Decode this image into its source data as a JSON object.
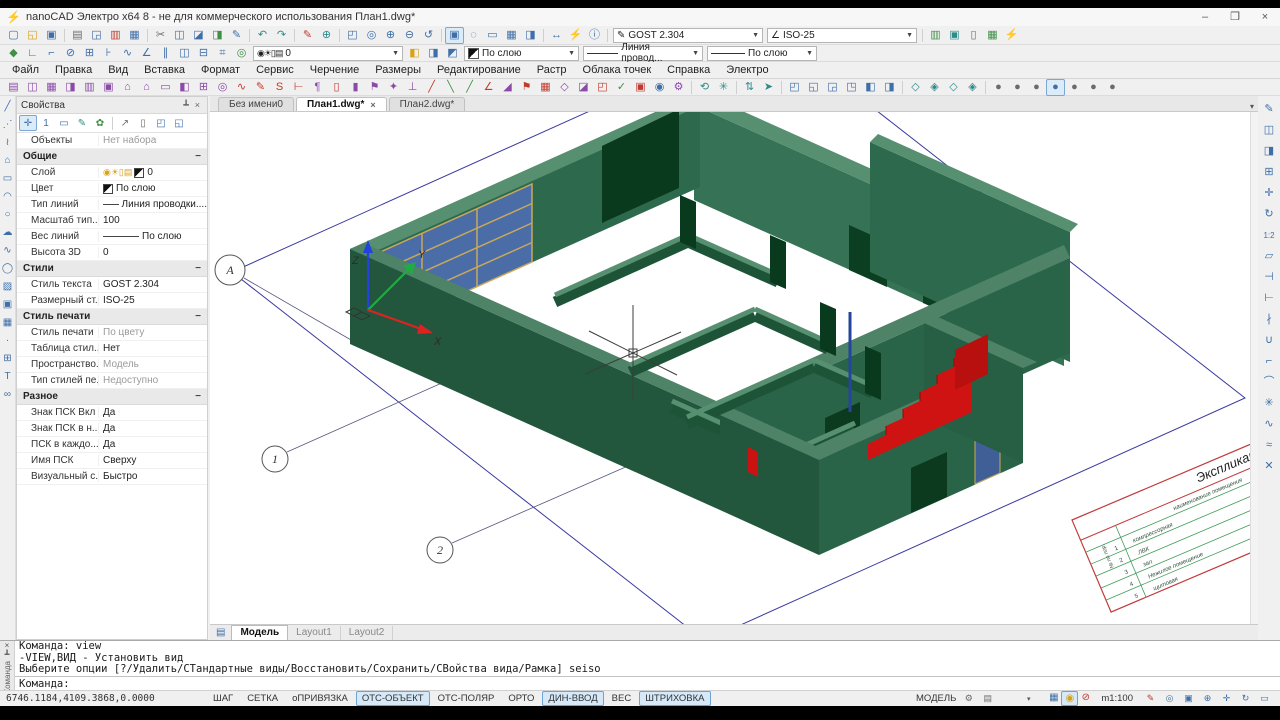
{
  "window": {
    "title": "nanoCAD Электро x64 8 - не для коммерческого использования План1.dwg*",
    "app_icon": "⚡",
    "controls": {
      "minimize": "–",
      "maximize": "❒",
      "close": "×"
    }
  },
  "menu": {
    "items": [
      "Файл",
      "Правка",
      "Вид",
      "Вставка",
      "Формат",
      "Сервис",
      "Черчение",
      "Размеры",
      "Редактирование",
      "Растр",
      "Облака точек",
      "Справка",
      "Электро"
    ]
  },
  "toolbar1": {
    "icons": [
      [
        "new",
        "▢",
        "b"
      ],
      [
        "open",
        "◱",
        "y"
      ],
      [
        "save",
        "▣",
        "b"
      ],
      [
        "|"
      ],
      [
        "print",
        "▤",
        "k"
      ],
      [
        "preview",
        "◲",
        "b"
      ],
      [
        "plot",
        "▥",
        "r"
      ],
      [
        "publish",
        "▦",
        "b"
      ],
      [
        "|"
      ],
      [
        "cut",
        "✂",
        "k"
      ],
      [
        "copy",
        "◫",
        "b"
      ],
      [
        "paste",
        "◪",
        "b"
      ],
      [
        "paste-format",
        "◨",
        "g"
      ],
      [
        "match-props",
        "✎",
        "b"
      ],
      [
        "|"
      ],
      [
        "undo",
        "↶",
        "t"
      ],
      [
        "redo",
        "↷",
        "t"
      ],
      [
        "|"
      ],
      [
        "marker",
        "✎",
        "r"
      ],
      [
        "attach",
        "⊕",
        "t"
      ],
      [
        "|"
      ],
      [
        "zoom-window",
        "◰",
        "b"
      ],
      [
        "zoom-dynamic",
        "◎",
        "b"
      ],
      [
        "zoom-in",
        "⊕",
        "b"
      ],
      [
        "zoom-out",
        "⊖",
        "b"
      ],
      [
        "zoom-previous",
        "↺",
        "b"
      ],
      [
        "|"
      ],
      [
        "panels",
        "▣",
        "b",
        1
      ],
      [
        "search",
        "◌",
        "b"
      ],
      [
        "screen",
        "▭",
        "b"
      ],
      [
        "sheets",
        "▦",
        "b"
      ],
      [
        "properties",
        "◨",
        "b"
      ],
      [
        "|"
      ],
      [
        "distance",
        "↔",
        "b"
      ],
      [
        "quick-measure",
        "⚡",
        "y"
      ],
      [
        "info",
        "ⓘ",
        "b"
      ]
    ],
    "text_style": {
      "icon": "✎",
      "value": "GOST 2.304"
    },
    "dim_style": {
      "icon": "∠",
      "value": "ISO-25"
    },
    "right_icons": [
      [
        "el-base",
        "▥",
        "g"
      ],
      [
        "el-model",
        "▣",
        "t"
      ],
      [
        "el-doc",
        "▯",
        "k"
      ],
      [
        "el-table",
        "▦",
        "g"
      ],
      [
        "el-run",
        "⚡",
        "t"
      ]
    ]
  },
  "toolbar2": {
    "icons": [
      [
        "snap-settings",
        "◆",
        "g"
      ],
      [
        "osnap",
        "∟",
        "b"
      ],
      [
        "ortho-mode",
        "⌐",
        "b"
      ],
      [
        "no-track",
        "⊘",
        "b"
      ],
      [
        "track",
        "⊞",
        "b"
      ],
      [
        "dyn-input",
        "⊦",
        "b"
      ],
      [
        "wave",
        "∿",
        "b"
      ],
      [
        "angle",
        "∠",
        "b"
      ],
      [
        "parallel",
        "∥",
        "b"
      ],
      [
        "copy-mode",
        "◫",
        "b"
      ],
      [
        "array-mode",
        "⊟",
        "b"
      ],
      [
        "grid-mode",
        "⌗",
        "b"
      ],
      [
        "magnet",
        "◎",
        "g"
      ]
    ],
    "layer": {
      "icons": "◉☀▯▤",
      "value": "0"
    },
    "locks": [
      [
        "lock-layer",
        "◧",
        "y"
      ],
      [
        "lock-object",
        "◨",
        "b"
      ],
      [
        "lock-vp",
        "◩",
        "b"
      ]
    ],
    "color": {
      "value": "По слою"
    },
    "linetype": {
      "value": "Линия провод..."
    },
    "lineweight": {
      "value": "По слою"
    }
  },
  "toolbar3": {
    "icons": [
      [
        "project-doc",
        "▤",
        "p"
      ],
      [
        "project-open",
        "◫",
        "p"
      ],
      [
        "project-props",
        "▦",
        "p"
      ],
      [
        "project-export",
        "◨",
        "p"
      ],
      [
        "db-manager",
        "▥",
        "p"
      ],
      [
        "db-element",
        "▣",
        "p"
      ],
      [
        "building",
        "⌂",
        "p"
      ],
      [
        "floor",
        "⌂",
        "p"
      ],
      [
        "room",
        "▭",
        "p"
      ],
      [
        "zone",
        "◧",
        "p"
      ],
      [
        "grid-plan",
        "⊞",
        "p"
      ],
      [
        "equipment",
        "◎",
        "p"
      ],
      [
        "wire",
        "∿",
        "r"
      ],
      [
        "wire-draw",
        "✎",
        "r"
      ],
      [
        "wire-curve",
        "S",
        "r"
      ],
      [
        "wire-tap",
        "⊢",
        "r"
      ],
      [
        "section",
        "¶",
        "p"
      ],
      [
        "cabinet",
        "▯",
        "r"
      ],
      [
        "cabinet2",
        "▮",
        "p"
      ],
      [
        "mark",
        "⚑",
        "p"
      ],
      [
        "luminaire",
        "✦",
        "p"
      ],
      [
        "pole",
        "⊥",
        "p"
      ],
      [
        "trace1",
        "╱",
        "r"
      ],
      [
        "trace2",
        "╲",
        "g"
      ],
      [
        "trace3",
        "╱",
        "g"
      ],
      [
        "angle-set",
        "∠",
        "r"
      ],
      [
        "triangle",
        "◢",
        "p"
      ],
      [
        "flag",
        "⚑",
        "r"
      ],
      [
        "panel-board",
        "▦",
        "r"
      ],
      [
        "diamond",
        "◇",
        "p"
      ],
      [
        "swatch-tool",
        "◪",
        "p"
      ],
      [
        "window-tool",
        "◰",
        "r"
      ],
      [
        "check",
        "✓",
        "g"
      ],
      [
        "report",
        "▣",
        "r"
      ],
      [
        "camera",
        "◉",
        "b"
      ],
      [
        "settings",
        "⚙",
        "p"
      ]
    ],
    "nav_icons": [
      [
        "orbit",
        "⟲",
        "t"
      ],
      [
        "orbit-free",
        "✳",
        "t"
      ],
      [
        "|"
      ],
      [
        "walk",
        "⇅",
        "t"
      ],
      [
        "fly",
        "➤",
        "t"
      ],
      [
        "|"
      ],
      [
        "view-top",
        "◰",
        "b"
      ],
      [
        "view-bottom",
        "◱",
        "b"
      ],
      [
        "view-left",
        "◲",
        "b"
      ],
      [
        "view-right",
        "◳",
        "b"
      ],
      [
        "view-front",
        "◧",
        "b"
      ],
      [
        "view-back",
        "◨",
        "b"
      ],
      [
        "|"
      ],
      [
        "iso-sw",
        "◇",
        "t"
      ],
      [
        "iso-se",
        "◈",
        "t"
      ],
      [
        "iso-ne",
        "◇",
        "t"
      ],
      [
        "iso-nw",
        "◈",
        "t"
      ],
      [
        "|"
      ],
      [
        "vs-2d",
        "●",
        "k"
      ],
      [
        "vs-wireframe",
        "●",
        "k"
      ],
      [
        "vs-hidden",
        "●",
        "k"
      ],
      [
        "vs-shaded",
        "●",
        "b",
        1
      ],
      [
        "vs-gouraud",
        "●",
        "k"
      ],
      [
        "vs-flat",
        "●",
        "k"
      ],
      [
        "vs-xray",
        "●",
        "k"
      ]
    ]
  },
  "left_toolbar": {
    "icons": [
      [
        "line",
        "╱",
        "b"
      ],
      [
        "ray",
        "⋰",
        "b"
      ],
      [
        "polyline",
        "≀",
        "b"
      ],
      [
        "polygon",
        "⌂",
        "b"
      ],
      [
        "rectangle",
        "▭",
        "b"
      ],
      [
        "arc",
        "◠",
        "b"
      ],
      [
        "circle",
        "○",
        "b"
      ],
      [
        "cloud",
        "☁",
        "b"
      ],
      [
        "spline",
        "∿",
        "b"
      ],
      [
        "ellipse",
        "◯",
        "b"
      ],
      [
        "hatch",
        "▨",
        "b"
      ],
      [
        "region",
        "▣",
        "b"
      ],
      [
        "image",
        "▦",
        "b"
      ],
      [
        "point",
        "·",
        "b"
      ],
      [
        "table",
        "⊞",
        "b"
      ],
      [
        "text",
        "T",
        "b"
      ],
      [
        "group",
        "∞",
        "b"
      ]
    ]
  },
  "right_toolbar": {
    "icons": [
      [
        "erase",
        "✎",
        "b"
      ],
      [
        "copy-obj",
        "◫",
        "b"
      ],
      [
        "mirror",
        "◨",
        "b"
      ],
      [
        "array",
        "⊞",
        "b"
      ],
      [
        "move",
        "✛",
        "b"
      ],
      [
        "rotate",
        "↻",
        "b"
      ],
      [
        "scale",
        "1:2",
        "txt"
      ],
      [
        "stretch",
        "▱",
        "b"
      ],
      [
        "trim",
        "⊣",
        "b"
      ],
      [
        "extend",
        "⊢",
        "b"
      ],
      [
        "break",
        "∤",
        "b"
      ],
      [
        "join",
        "∪",
        "b"
      ],
      [
        "chamfer",
        "⌐",
        "b"
      ],
      [
        "fillet",
        "⌒",
        "b"
      ],
      [
        "explode",
        "✳",
        "b"
      ],
      [
        "pedit",
        "∿",
        "b"
      ],
      [
        "spline-edit",
        "≈",
        "b"
      ],
      [
        "delete",
        "✕",
        "b"
      ]
    ]
  },
  "properties": {
    "title": "Свойства",
    "pin": "┻",
    "close": "×",
    "collapse_glyph": "−",
    "toolbar_icons": [
      [
        "select-append",
        "✛",
        "b",
        1
      ],
      [
        "select-single",
        "1",
        "b"
      ],
      [
        "calc",
        "▭",
        "b"
      ],
      [
        "quick-select",
        "✎",
        "t"
      ],
      [
        "filter",
        "✿",
        "g"
      ],
      [
        "|"
      ],
      [
        "copy-props",
        "↗",
        "k"
      ],
      [
        "paste-props",
        "▯",
        "k"
      ],
      [
        "pin-sel",
        "◰",
        "b"
      ],
      [
        "pin-sel2",
        "◱",
        "b"
      ]
    ],
    "rows": [
      {
        "type": "row",
        "label": "Объекты",
        "value": "Нет набора",
        "muted": true
      },
      {
        "type": "section",
        "label": "Общие"
      },
      {
        "type": "row",
        "label": "Слой",
        "value": "0",
        "extra": "layericons"
      },
      {
        "type": "row",
        "label": "Цвет",
        "value": "По слою",
        "extra": "swatch"
      },
      {
        "type": "row",
        "label": "Тип линий",
        "value": "Линия проводки....",
        "extra": "line"
      },
      {
        "type": "row",
        "label": "Масштаб тип...",
        "value": "100"
      },
      {
        "type": "row",
        "label": "Вес линий",
        "value": "По слою",
        "extra": "line"
      },
      {
        "type": "row",
        "label": "Высота 3D",
        "value": "0"
      },
      {
        "type": "section",
        "label": "Стили"
      },
      {
        "type": "row",
        "label": "Стиль текста",
        "value": "GOST 2.304"
      },
      {
        "type": "row",
        "label": "Размерный ст...",
        "value": "ISO-25"
      },
      {
        "type": "section",
        "label": "Стиль печати"
      },
      {
        "type": "row",
        "label": "Стиль печати",
        "value": "По цвету",
        "muted": true
      },
      {
        "type": "row",
        "label": "Таблица стил...",
        "value": "Нет"
      },
      {
        "type": "row",
        "label": "Пространство...",
        "value": "Модель",
        "muted": true
      },
      {
        "type": "row",
        "label": "Тип стилей пе...",
        "value": "Недоступно",
        "muted": true
      },
      {
        "type": "section",
        "label": "Разное"
      },
      {
        "type": "row",
        "label": "Знак ПСК Вкл",
        "value": "Да"
      },
      {
        "type": "row",
        "label": "Знак ПСК в н...",
        "value": "Да"
      },
      {
        "type": "row",
        "label": "ПСК в каждо...",
        "value": "Да"
      },
      {
        "type": "row",
        "label": "Имя ПСК",
        "value": "Сверху"
      },
      {
        "type": "row",
        "label": "Визуальный с...",
        "value": "Быстро"
      }
    ]
  },
  "doc_tabs": [
    {
      "label": "Без имени0",
      "active": false
    },
    {
      "label": "План1.dwg*",
      "active": true,
      "close": "×"
    },
    {
      "label": "План2.dwg*",
      "active": false
    }
  ],
  "doc_tab_list_arrow": "▾",
  "layout_tabs": [
    {
      "label": "Модель",
      "active": true
    },
    {
      "label": "Layout1",
      "active": false
    },
    {
      "label": "Layout2",
      "active": false
    }
  ],
  "command": {
    "tab_label": "Команда",
    "close": "×",
    "pin": "┻",
    "history": [
      "Команда: view",
      "-VIEW,ВИД - Установить вид",
      "Выберите опции [?/Удалить/СТандартные виды/Восстановить/Сохранить/СВойства вида/Рамка] seiso"
    ],
    "prompt": "Команда:"
  },
  "status": {
    "coords": "6746.1184,4109.3868,0.0000",
    "toggles": [
      {
        "label": "ШАГ",
        "active": false
      },
      {
        "label": "СЕТКА",
        "active": false
      },
      {
        "label": "оПРИВЯЗКА",
        "active": false
      },
      {
        "label": "ОТС-ОБЪЕКТ",
        "active": true
      },
      {
        "label": "ОТС-ПОЛЯР",
        "active": false
      },
      {
        "label": "ОРТО",
        "active": false
      },
      {
        "label": "ДИН-ВВОД",
        "active": true
      },
      {
        "label": "ВЕС",
        "active": false
      },
      {
        "label": "ШТРИХОВКА",
        "active": true
      }
    ],
    "model_label": "МОДЕЛЬ",
    "model_icons": [
      [
        "workspace",
        "⚙",
        "k"
      ],
      [
        "paper",
        "▤",
        "k"
      ]
    ],
    "dropdown_arrow": "▾",
    "mini_toggles": [
      [
        "viewports",
        "▦",
        "b",
        0
      ],
      [
        "lighting",
        "◉",
        "y",
        1
      ],
      [
        "no-plot",
        "⊘",
        "r",
        0
      ]
    ],
    "scale": "m1:100",
    "nav_icons": [
      [
        "redline",
        "✎",
        "r"
      ],
      [
        "zoom",
        "◎",
        "b"
      ],
      [
        "zoom-box",
        "▣",
        "b"
      ],
      [
        "zoom-plus",
        "⊕",
        "b"
      ],
      [
        "pan",
        "✛",
        "b"
      ],
      [
        "regen",
        "↻",
        "b"
      ],
      [
        "fullscreen",
        "▭",
        "b"
      ]
    ]
  },
  "canvas": {
    "bubbles": [
      {
        "label": "А"
      },
      {
        "label": "1"
      },
      {
        "label": "2"
      }
    ],
    "ucs": {
      "x": "X",
      "y": "Y",
      "z": "Z"
    },
    "title_block": {
      "title": "Экспликация",
      "num_header": "№ по пор.",
      "name_header": "наименование помещения",
      "rows": [
        {
          "n": "1",
          "name": "компрессорная"
        },
        {
          "n": "2",
          "name": "ЛВК"
        },
        {
          "n": "3",
          "name": "зал"
        },
        {
          "n": "4",
          "name": "Нежилое помещение"
        },
        {
          "n": "5",
          "name": "щитовая"
        }
      ]
    }
  }
}
